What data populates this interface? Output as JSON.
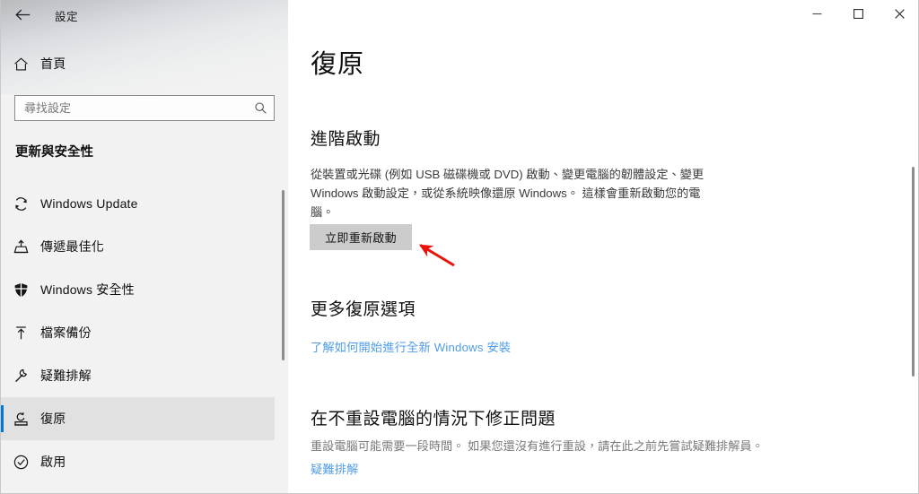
{
  "window": {
    "title": "設定",
    "back_icon": "back-arrow-icon",
    "controls": {
      "minimize": "minimize-icon",
      "maximize": "maximize-icon",
      "close": "close-icon"
    }
  },
  "sidebar": {
    "home": {
      "label": "首頁",
      "icon": "home-icon"
    },
    "search": {
      "placeholder": "尋找設定",
      "value": "",
      "icon": "search-icon"
    },
    "category_title": "更新與安全性",
    "items": [
      {
        "label": "Windows Update",
        "icon": "sync-refresh-icon",
        "selected": false
      },
      {
        "label": "傳遞最佳化",
        "icon": "delivery-optimization-icon",
        "selected": false
      },
      {
        "label": "Windows 安全性",
        "icon": "shield-icon",
        "selected": false
      },
      {
        "label": "檔案備份",
        "icon": "backup-upload-icon",
        "selected": false
      },
      {
        "label": "疑難排解",
        "icon": "wrench-icon",
        "selected": false
      },
      {
        "label": "復原",
        "icon": "recovery-icon",
        "selected": true
      },
      {
        "label": "啟用",
        "icon": "check-circle-icon",
        "selected": false
      }
    ],
    "scrollbar": "sidebar-scrollbar"
  },
  "main": {
    "page_title": "復原",
    "advanced_startup": {
      "heading": "進階啟動",
      "body": "從裝置或光碟 (例如 USB 磁碟機或 DVD) 啟動、變更電腦的韌體設定、變更 Windows 啟動設定，或從系統映像還原 Windows。 這樣會重新啟動您的電腦。",
      "button_label": "立即重新啟動"
    },
    "more_recovery": {
      "heading": "更多復原選項",
      "link_label": "了解如何開始進行全新 Windows 安裝"
    },
    "fix_without_reset": {
      "heading": "在不重設電腦的情況下修正問題",
      "body": "重設電腦可能需要一段時間。 如果您還沒有進行重設，請在此之前先嘗試疑難排解員。",
      "link_label": "疑難排解"
    },
    "scrollbar": "main-scrollbar"
  },
  "annotation": {
    "arrow": "red-pointer-arrow"
  },
  "colors": {
    "accent": "#0078d4",
    "link": "#4f9ce8",
    "button_face": "#cccccc",
    "sidebar_bg": "#f2f2f2",
    "annotation_red": "#e8140c"
  }
}
